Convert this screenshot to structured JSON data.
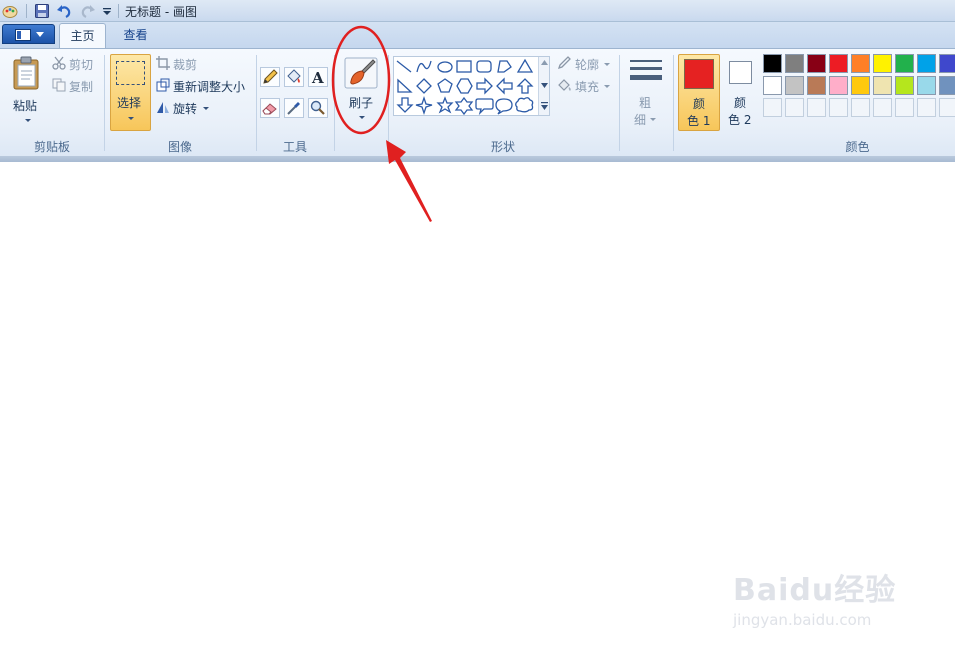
{
  "window": {
    "title": "无标题 - 画图"
  },
  "tabs": [
    {
      "label": "主页"
    },
    {
      "label": "查看"
    }
  ],
  "clipboard": {
    "paste": "粘贴",
    "cut": "剪切",
    "copy": "复制",
    "group": "剪贴板"
  },
  "image": {
    "select": "选择",
    "crop": "裁剪",
    "resize": "重新调整大小",
    "rotate": "旋转",
    "group": "图像"
  },
  "tools": {
    "group": "工具"
  },
  "brushes": {
    "label": "刷子"
  },
  "shapes": {
    "outline": "轮廓",
    "fill": "填充",
    "group": "形状"
  },
  "size": {
    "label_top": "粗",
    "label_bottom": "细"
  },
  "colors": {
    "color1_top": "颜",
    "color1_bottom": "色 1",
    "color2_top": "颜",
    "color2_bottom": "色 2",
    "group": "颜色",
    "color1_value": "#e52222",
    "color2_value": "#ffffff",
    "palette_row1": [
      "#000000",
      "#7f7f7f",
      "#880015",
      "#ed1c24",
      "#ff7f27",
      "#fff200",
      "#22b14c",
      "#00a2e8",
      "#3f48cc"
    ],
    "palette_row2": [
      "#ffffff",
      "#c3c3c3",
      "#b97a57",
      "#ffaec9",
      "#ffc90e",
      "#efe4b0",
      "#b5e61d",
      "#99d9ea",
      "#7092be"
    ]
  },
  "accent": {
    "annotation": "#e02020",
    "active_button": "#fcd77a"
  },
  "watermark": {
    "brand": "Baidu经验",
    "url": "jingyan.baidu.com"
  }
}
